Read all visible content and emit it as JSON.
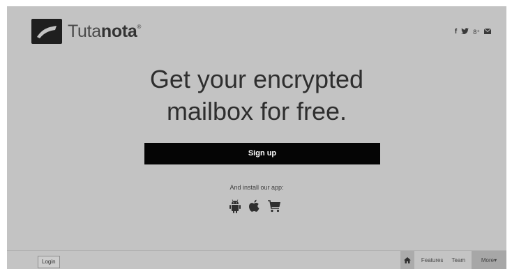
{
  "brand": {
    "name_light": "Tuta",
    "name_bold": "nota",
    "trademark": "®",
    "logo_icon": "tutanota-logo-icon"
  },
  "social": [
    {
      "icon": "facebook-icon",
      "glyph": "f"
    },
    {
      "icon": "twitter-icon",
      "glyph": "🐦"
    },
    {
      "icon": "google-plus-icon",
      "glyph": "8⁺"
    },
    {
      "icon": "email-icon",
      "glyph": "✉"
    }
  ],
  "hero": {
    "line1": "Get your encrypted",
    "line2": "mailbox for free."
  },
  "signup": {
    "label": "Sign up"
  },
  "install": {
    "text": "And install our app:"
  },
  "apps": [
    {
      "icon": "android-icon"
    },
    {
      "icon": "apple-icon"
    },
    {
      "icon": "cart-icon"
    }
  ],
  "footer": {
    "login_label": "Login",
    "nav": {
      "home_icon": "home-icon",
      "features": "Features",
      "team": "Team",
      "more": "More▾"
    }
  },
  "colors": {
    "panel_bg": "#c3c3c3",
    "signup_bg": "#050505",
    "signup_text": "#ffffff"
  }
}
